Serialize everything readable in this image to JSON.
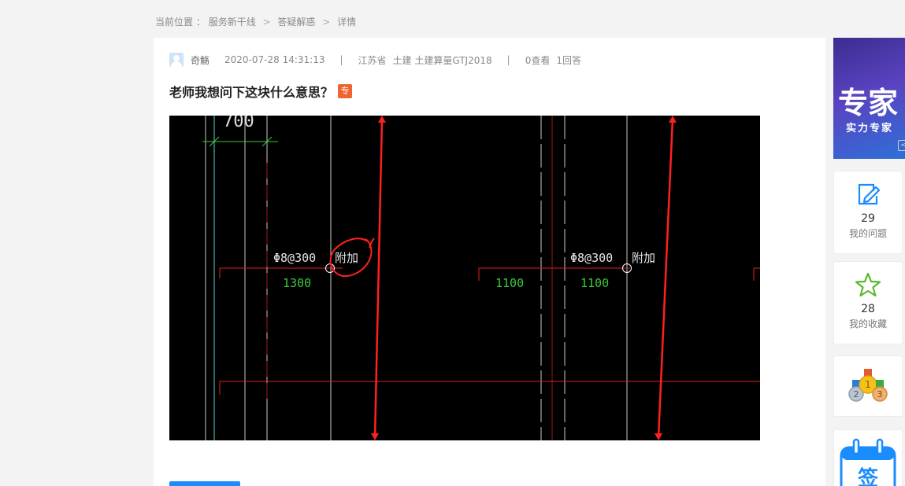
{
  "breadcrumb": {
    "label": "当前位置",
    "colon": "：",
    "items": [
      "服务新干线",
      "答疑解惑",
      "详情"
    ],
    "sep": ">"
  },
  "meta": {
    "user": "奇觞",
    "datetime": "2020-07-28 14:31:13",
    "pipe": "|",
    "province": "江苏省",
    "category": "土建 土建算量GTJ2018",
    "views": "0查看",
    "answers": "1回答"
  },
  "question": {
    "title": "老师我想问下这块什么意思？",
    "badge": "专"
  },
  "cad": {
    "annot1": "Φ8@300",
    "annot1_suffix": "附加",
    "annot2": "Φ8@300",
    "annot2_suffix": "附加",
    "dim1": "1300",
    "dim2": "1100",
    "dim3": "1100",
    "top_text": "700"
  },
  "banner": {
    "title": "专家",
    "subtitle": "实力专家",
    "chevron": "<"
  },
  "side": {
    "questions": {
      "count": "29",
      "label": "我的问题",
      "icon": "edit-note-icon"
    },
    "favorites": {
      "count": "28",
      "label": "我的收藏",
      "icon": "star-icon"
    },
    "ranking": {
      "icon": "medals-icon",
      "medals": [
        "2",
        "1",
        "3"
      ]
    },
    "signin": {
      "icon": "calendar-sign-icon",
      "label": "签"
    }
  },
  "colors": {
    "accent": "#1a8cfc",
    "badge": "#f0642e",
    "cad_bg": "#000000",
    "red_line": "#ff2020"
  }
}
